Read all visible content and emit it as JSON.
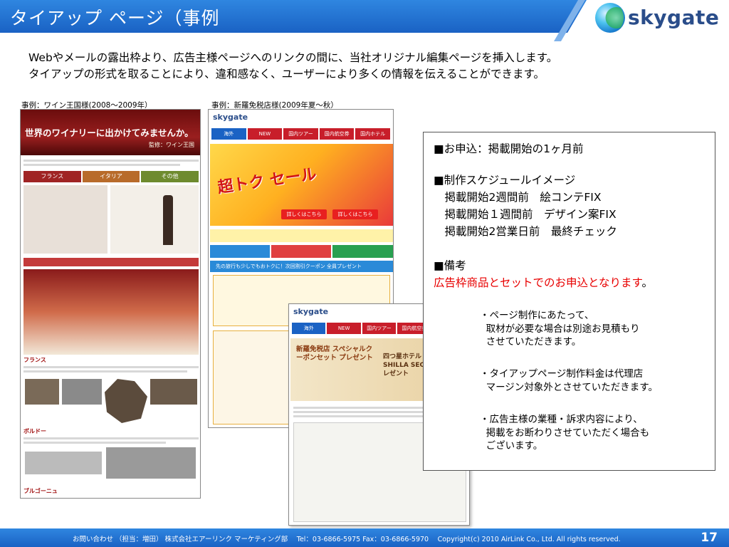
{
  "header": {
    "title": "タイアップ ページ（事例",
    "logo_text": "skygate"
  },
  "intro": {
    "line1": "Webやメールの露出枠より、広告主様ページへのリンクの間に、当社オリジナル編集ページを挿入します。",
    "line2": "タイアップの形式を取ることにより、違和感なく、ユーザーにより多くの情報を伝えることができます。"
  },
  "examples": {
    "left_caption": "事例：ワイン王国様(2008～2009年）",
    "right_caption": "事例：新羅免税店様(2009年夏～秋）"
  },
  "wine_mock": {
    "banner_title": "世界のワイナリーに出かけてみませんか。",
    "banner_sub": "監修：ワイン王国",
    "tabs": [
      "フランス",
      "イタリア",
      "その他"
    ],
    "sections": [
      "フランス",
      "ボルドー",
      "ブルゴーニュ"
    ]
  },
  "shilla_mock": {
    "logo": "skygate",
    "nav": [
      "海外",
      "NEW",
      "国内ツアー",
      "国内航空券",
      "国内ホテル"
    ],
    "hero_title": "超トク セール",
    "hero_buttons": [
      "詳しくはこちら",
      "詳しくはこちら"
    ],
    "strip": "先の旅行も少しでもおトクに！次回割引クーポン 全員プレゼント",
    "card_title": "新羅免税店 スペシャルクーポンセット プレゼント",
    "card_hotel": "四つ星ホテル THE SHILLA SEOUL 宿泊券プレゼント"
  },
  "info_box": {
    "line1": "■お申込：掲載開始の1ヶ月前",
    "line2": "■制作スケジュールイメージ",
    "line3": "　掲載開始2週間前　絵コンテFIX",
    "line4": "　掲載開始１週間前　デザイン案FIX",
    "line5": "　掲載開始2営業日前　最終チェック",
    "line6": "■備考",
    "line7_red": "広告枠商品とセットでのお申込となります",
    "line7_end": "。"
  },
  "notes": {
    "note1": "・ページ制作にあたって、\n  取材が必要な場合は別途お見積もり\n  させていただきます。",
    "note2": "・タイアップページ制作料金は代理店\n  マージン対象外とさせていただきます。",
    "note3": "・広告主様の業種・訴求内容により、\n  掲載をお断わりさせていただく場合も\n  ございます。"
  },
  "footer": {
    "text": "お問い合わせ （担当：増田） 株式会社エアーリンク マーケティング部　 Tel：03-6866-5975  Fax：03-6866-5970　 Copyright(c) 2010  AirLink Co., Ltd. All rights reserved.",
    "page_number": "17"
  }
}
